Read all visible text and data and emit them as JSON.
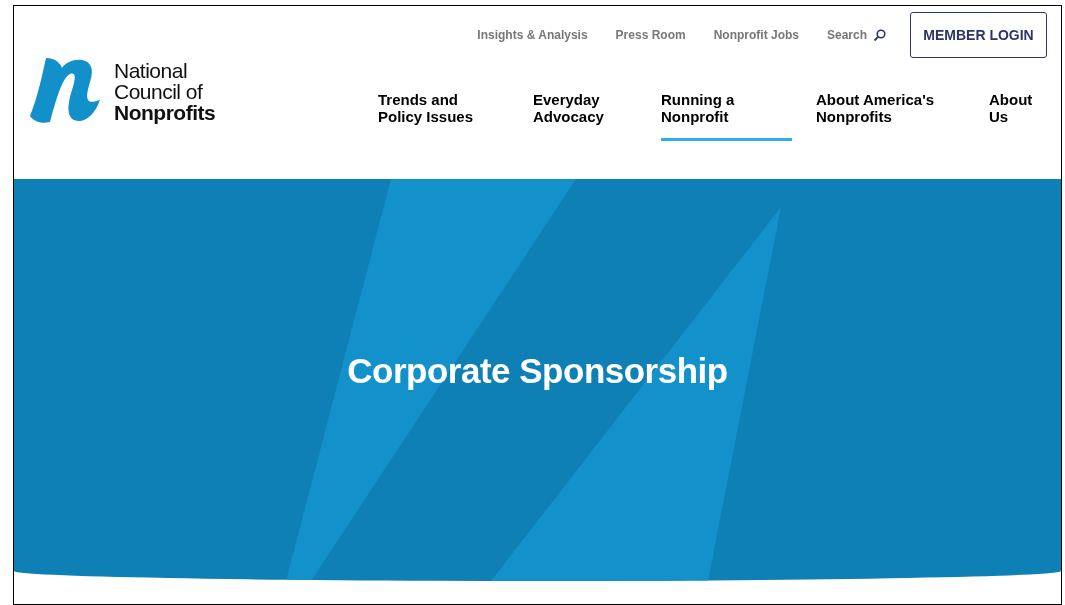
{
  "logo": {
    "lines": [
      "National",
      "Council of",
      "Nonprofits"
    ]
  },
  "utility_links": [
    "Insights & Analysis",
    "Press Room",
    "Nonprofit Jobs"
  ],
  "search": {
    "label": "Search"
  },
  "login_button": "MEMBER LOGIN",
  "nav": [
    {
      "lines": [
        "Trends and",
        "Policy Issues"
      ],
      "selected": false
    },
    {
      "lines": [
        "Everyday",
        "Advocacy"
      ],
      "selected": false
    },
    {
      "lines": [
        "Running a",
        "Nonprofit"
      ],
      "selected": true
    },
    {
      "lines": [
        "About America's",
        "Nonprofits"
      ],
      "selected": false
    },
    {
      "lines": [
        "About",
        "Us"
      ],
      "selected": false
    }
  ],
  "hero": {
    "title": "Corporate Sponsorship"
  }
}
